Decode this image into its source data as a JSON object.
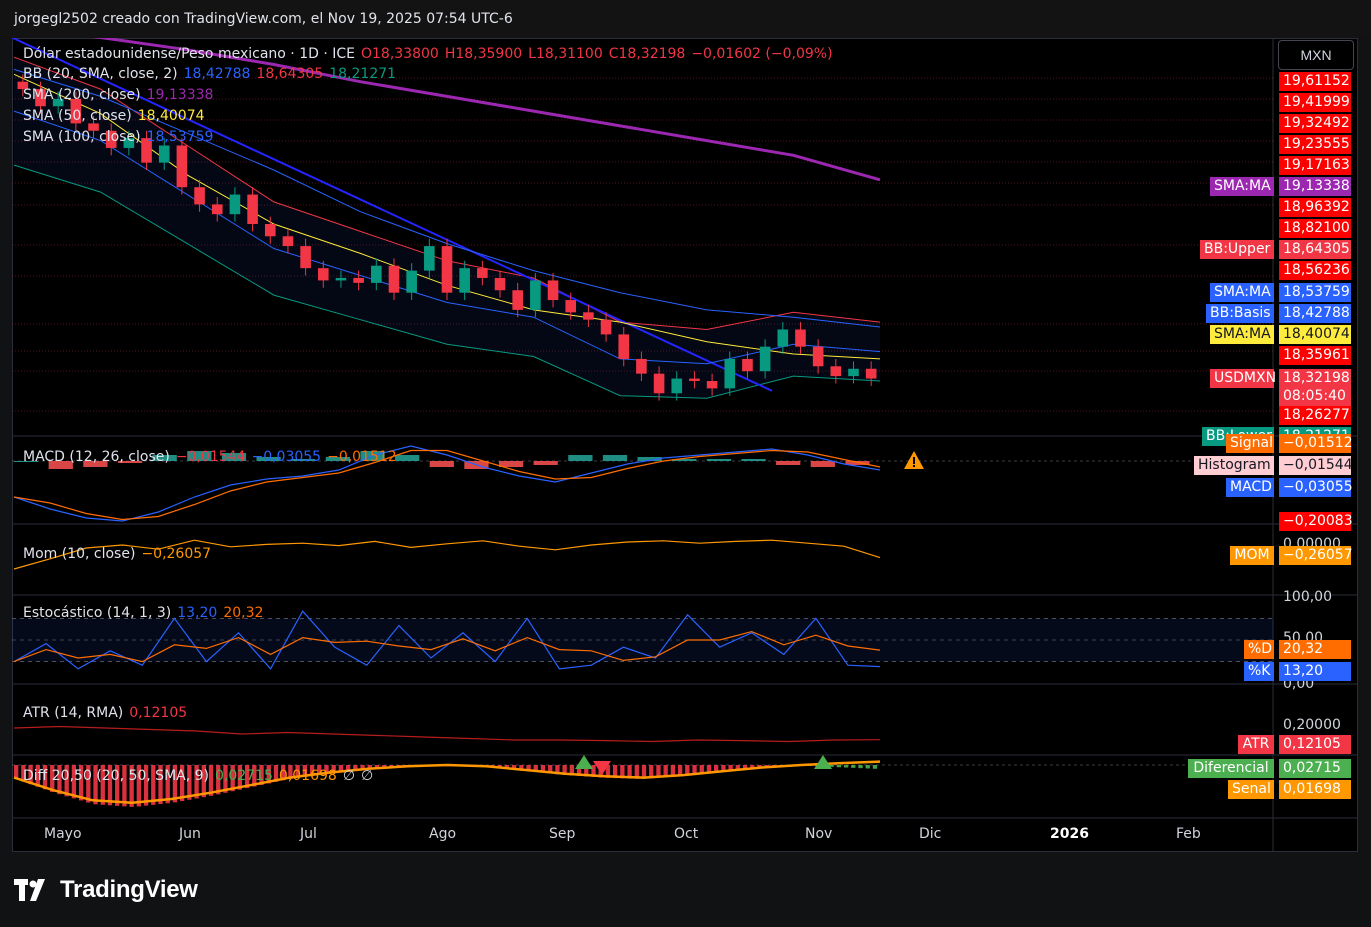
{
  "header": {
    "credit": "jorgegl2502 creado con TradingView.com, el Nov 19, 2025 07:54 UTC-6"
  },
  "currency_button": "MXN",
  "main_legend": {
    "symbol": "Dólar estadounidense/Peso mexicano · 1D · ICE",
    "open": "O18,33800",
    "high": "H18,35900",
    "low": "L18,31100",
    "close": "C18,32198",
    "change": "−0,01602 (−0,09%)"
  },
  "indicators": [
    {
      "label": "BB (20, SMA, close, 2)",
      "values": [
        "18,42788",
        "18,64305",
        "18,21271"
      ],
      "colors": [
        "#2962ff",
        "#f23645",
        "#089981"
      ]
    },
    {
      "label": "SMA (200, close)",
      "values": [
        "19,13338"
      ],
      "colors": [
        "#9c27b0"
      ]
    },
    {
      "label": "SMA (50, close)",
      "values": [
        "18,40074"
      ],
      "colors": [
        "#ffeb3b"
      ]
    },
    {
      "label": "SMA (100, close)",
      "values": [
        "18,53759"
      ],
      "colors": [
        "#2962ff"
      ]
    }
  ],
  "macd_legend": {
    "label": "MACD (12, 26, close)",
    "values": [
      "−0,01544",
      "−0,03055",
      "−0,01512"
    ]
  },
  "mom_legend": {
    "label": "Mom (10, close)",
    "values": [
      "−0,26057"
    ]
  },
  "stoch_legend": {
    "label": "Estocástico (14, 1, 3)",
    "values": [
      "13,20",
      "20,32"
    ]
  },
  "atr_legend": {
    "label": "ATR (14, RMA)",
    "values": [
      "0,12105"
    ]
  },
  "diff_legend": {
    "label": "Diff 20,50 (20, 50, SMA, 9)",
    "values": [
      "0,02715",
      "0,01698",
      "∅",
      "∅"
    ]
  },
  "price_axis": [
    "19,61152",
    "19,41999",
    "19,32492",
    "19,23555",
    "19,17163",
    "18,96392",
    "18,82100",
    "18,56236",
    "18,35961",
    "18,26277"
  ],
  "price_tags": [
    {
      "name": "SMA:MA",
      "value": "19,13338",
      "bg": "#9c27b0"
    },
    {
      "name": "BB:Upper",
      "value": "18,64305",
      "bg": "#f23645"
    },
    {
      "name": "SMA:MA",
      "value": "18,53759",
      "bg": "#2962ff"
    },
    {
      "name": "BB:Basis",
      "value": "18,42788",
      "bg": "#2962ff"
    },
    {
      "name": "SMA:MA",
      "value": "18,40074",
      "bg": "#ffeb3b"
    },
    {
      "name": "USDMXN",
      "value": "18,32198",
      "bg": "#f23645"
    },
    {
      "name": "",
      "value": "08:05:40",
      "bg": "#f23645"
    },
    {
      "name": "BB:Lower",
      "value": "18,21271",
      "bg": "#089981"
    }
  ],
  "macd_tags": [
    {
      "name": "Signal",
      "value": "−0,01512",
      "bg": "#ff6d00"
    },
    {
      "name": "Histogram",
      "value": "−0,01544",
      "bg": "#ffcdd2"
    },
    {
      "name": "MACD",
      "value": "−0,03055",
      "bg": "#2962ff"
    }
  ],
  "macd_axis": [
    "−0,20083"
  ],
  "mom_axis": [
    "0,00000"
  ],
  "mom_tag": {
    "name": "MOM",
    "value": "−0,26057",
    "bg": "#ff9800"
  },
  "stoch_axis": [
    "100,00",
    "50,00",
    "0,00"
  ],
  "stoch_tags": [
    {
      "name": "%D",
      "value": "20,32",
      "bg": "#ff6d00"
    },
    {
      "name": "%K",
      "value": "13,20",
      "bg": "#2962ff"
    }
  ],
  "atr_axis": [
    "0,20000"
  ],
  "atr_tag": {
    "name": "ATR",
    "value": "0,12105",
    "bg": "#f23645"
  },
  "diff_tags": [
    {
      "name": "Diferencial",
      "value": "0,02715",
      "bg": "#4caf50"
    },
    {
      "name": "Senal",
      "value": "0,01698",
      "bg": "#ff9800"
    }
  ],
  "time_axis": [
    "Mayo",
    "Jun",
    "Jul",
    "Ago",
    "Sep",
    "Oct",
    "Nov",
    "Dic",
    "2026",
    "Feb"
  ],
  "logo": {
    "text": "TradingView",
    "icon": "tradingview-logo-icon"
  },
  "colors": {
    "up": "#089981",
    "down": "#f23645",
    "sma200": "#9c27b0",
    "sma50": "#ffeb3b",
    "sma100": "#2962ff",
    "trend": "#2424ff",
    "warning": "#ff9800"
  },
  "chart_data": [
    {
      "type": "candlestick",
      "symbol": "USDMXN",
      "ylim": [
        18.2,
        19.7
      ],
      "x_range": [
        "Apr 24 2025",
        "Nov 19 2025"
      ],
      "series": [
        {
          "name": "SMA (200, close)",
          "values": [
            19.75,
            19.71,
            19.66,
            19.6,
            19.53,
            19.47,
            19.41,
            19.35,
            19.29,
            19.23,
            19.13
          ]
        },
        {
          "name": "SMA (100, close)",
          "values": [
            19.58,
            19.47,
            19.32,
            19.17,
            19.0,
            18.87,
            18.76,
            18.67,
            18.6,
            18.57,
            18.53
          ]
        },
        {
          "name": "SMA (50, close)",
          "values": [
            19.56,
            19.4,
            19.15,
            18.95,
            18.83,
            18.7,
            18.6,
            18.55,
            18.47,
            18.42,
            18.4
          ]
        },
        {
          "name": "BB (20, SMA, close, 2)",
          "values": [
            19.41,
            19.29,
            19.07,
            18.85,
            18.74,
            18.63,
            18.57,
            18.4,
            18.38,
            18.46,
            18.43
          ]
        }
      ],
      "candles_close": [
        19.5,
        19.43,
        19.46,
        19.36,
        19.33,
        19.26,
        19.3,
        19.2,
        19.27,
        19.1,
        19.03,
        18.99,
        19.07,
        18.95,
        18.9,
        18.86,
        18.77,
        18.72,
        18.73,
        18.71,
        18.78,
        18.67,
        18.76,
        18.86,
        18.67,
        18.77,
        18.73,
        18.68,
        18.6,
        18.72,
        18.64,
        18.59,
        18.56,
        18.5,
        18.4,
        18.34,
        18.26,
        18.32,
        18.31,
        18.28,
        18.4,
        18.35,
        18.45,
        18.52,
        18.45,
        18.37,
        18.33,
        18.36,
        18.32
      ]
    },
    {
      "type": "bar",
      "title": "MACD (12, 26, close)",
      "values": [
        -0.12,
        -0.16,
        -0.19,
        -0.2,
        -0.17,
        -0.12,
        -0.08,
        -0.06,
        -0.05,
        -0.03,
        0.02,
        0.05,
        0.02,
        -0.02,
        -0.05,
        -0.07,
        -0.04,
        -0.01,
        0.01,
        0.02,
        0.03,
        0.04,
        0.02,
        -0.01,
        -0.03
      ]
    },
    {
      "type": "line",
      "title": "Mom (10, close)",
      "values": [
        -0.45,
        -0.28,
        -0.1,
        -0.05,
        -0.12,
        0.03,
        -0.08,
        -0.04,
        -0.02,
        -0.06,
        0.01,
        -0.09,
        -0.03,
        0.02,
        -0.07,
        -0.13,
        -0.05,
        0.0,
        0.02,
        -0.02,
        0.01,
        0.03,
        -0.02,
        -0.07,
        -0.26
      ]
    },
    {
      "type": "line",
      "title": "Estocástico (14, 1, 3)",
      "values": [
        20,
        45,
        10,
        35,
        15,
        80,
        20,
        60,
        10,
        90,
        40,
        15,
        70,
        25,
        60,
        20,
        80,
        10,
        15,
        40,
        25,
        85,
        40,
        60,
        30,
        80,
        15,
        13
      ]
    },
    {
      "type": "line",
      "title": "ATR (14, RMA)",
      "values": [
        0.16,
        0.165,
        0.16,
        0.155,
        0.15,
        0.14,
        0.145,
        0.14,
        0.135,
        0.13,
        0.125,
        0.12,
        0.12,
        0.118,
        0.115,
        0.12,
        0.118,
        0.115,
        0.12,
        0.121
      ]
    },
    {
      "type": "bar",
      "title": "Diff 20,50 (20, 50, SMA, 9)",
      "values": [
        -0.1,
        -0.2,
        -0.28,
        -0.3,
        -0.27,
        -0.22,
        -0.16,
        -0.1,
        -0.06,
        -0.03,
        -0.01,
        0.0,
        -0.01,
        -0.04,
        -0.07,
        -0.09,
        -0.1,
        -0.08,
        -0.05,
        -0.02,
        0.0,
        0.015,
        0.027
      ]
    }
  ]
}
